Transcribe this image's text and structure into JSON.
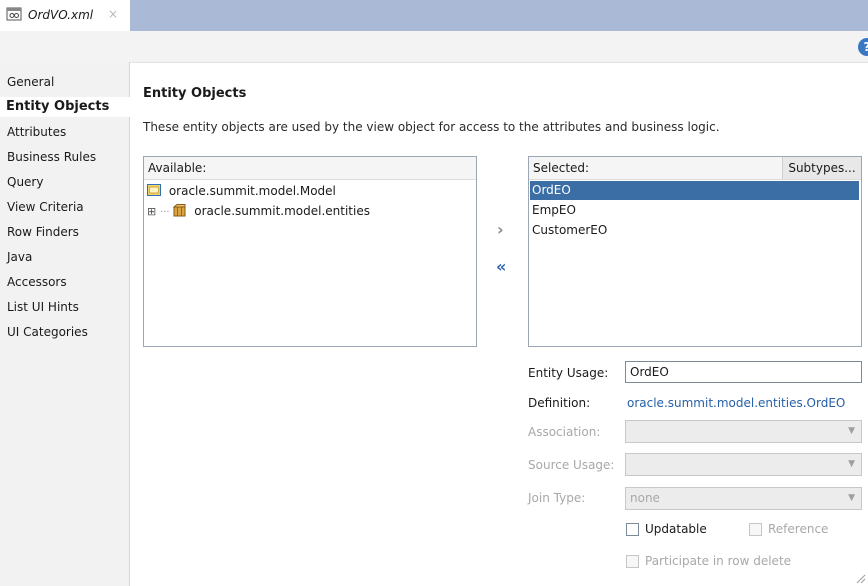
{
  "tab": {
    "label": "OrdVO.xml",
    "close": "×"
  },
  "help": {
    "glyph": "?"
  },
  "sidebar": {
    "items": [
      {
        "label": "General"
      },
      {
        "label": "Entity Objects"
      },
      {
        "label": "Attributes"
      },
      {
        "label": "Business Rules"
      },
      {
        "label": "Query"
      },
      {
        "label": "View Criteria"
      },
      {
        "label": "Row Finders"
      },
      {
        "label": "Java"
      },
      {
        "label": "Accessors"
      },
      {
        "label": "List UI Hints"
      },
      {
        "label": "UI Categories"
      }
    ],
    "selected_index": 1
  },
  "main": {
    "heading": "Entity Objects",
    "description": "These entity objects are used by the view object for access to the attributes and business logic."
  },
  "available": {
    "header": "Available:",
    "tree": [
      {
        "label": "oracle.summit.model.Model",
        "icon": "folder-icon"
      },
      {
        "label": "oracle.summit.model.entities",
        "icon": "package-icon",
        "expander": "⊞"
      }
    ]
  },
  "shuttle": {
    "move_right": "›",
    "remove_all": "«"
  },
  "selected": {
    "header": "Selected:",
    "subtypes_button": "Subtypes...",
    "items": [
      "OrdEO",
      "EmpEO",
      "CustomerEO"
    ],
    "selected_index": 0
  },
  "form": {
    "entity_usage": {
      "label": "Entity Usage:",
      "value": "OrdEO"
    },
    "definition": {
      "label": "Definition:",
      "value": "oracle.summit.model.entities.OrdEO"
    },
    "association": {
      "label": "Association:",
      "value": ""
    },
    "source_usage": {
      "label": "Source Usage:",
      "value": ""
    },
    "join_type": {
      "label": "Join Type:",
      "value": "none"
    },
    "updatable": {
      "label": "Updatable",
      "checked": false
    },
    "reference": {
      "label": "Reference",
      "checked": false
    },
    "participate": {
      "label": "Participate in row delete",
      "checked": false
    }
  },
  "colors": {
    "selection": "#3a6ea5",
    "tabstrip": "#a9b9d6",
    "link": "#2660a8"
  }
}
